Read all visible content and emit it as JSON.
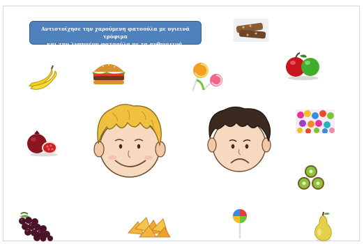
{
  "instruction": {
    "line1": "Αντιστοίχησε την χαρούμενη φατσούλα με υγιεινά τρόφιμα",
    "line2": "και την λυπημένη φατσούλα με τα ανθυγιεινά."
  },
  "faces": {
    "happy": "happy-face-icon",
    "sad": "sad-face-icon"
  },
  "foods": [
    {
      "icon": "cereal-bars-icon",
      "category": "unhealthy"
    },
    {
      "icon": "apples-icon",
      "category": "healthy"
    },
    {
      "icon": "bananas-icon",
      "category": "healthy"
    },
    {
      "icon": "burger-icon",
      "category": "unhealthy"
    },
    {
      "icon": "lollipops-icon",
      "category": "unhealthy"
    },
    {
      "icon": "candies-icon",
      "category": "unhealthy"
    },
    {
      "icon": "pomegranate-icon",
      "category": "healthy"
    },
    {
      "icon": "kiwis-icon",
      "category": "healthy"
    },
    {
      "icon": "grapes-icon",
      "category": "healthy"
    },
    {
      "icon": "chips-icon",
      "category": "unhealthy"
    },
    {
      "icon": "lollipop-icon",
      "category": "unhealthy"
    },
    {
      "icon": "pear-icon",
      "category": "healthy"
    }
  ],
  "colors": {
    "banner": "#4f81bd",
    "hair_happy": "#f0c040",
    "hair_sad": "#3b2a20",
    "skin": "#f7d9bf"
  }
}
